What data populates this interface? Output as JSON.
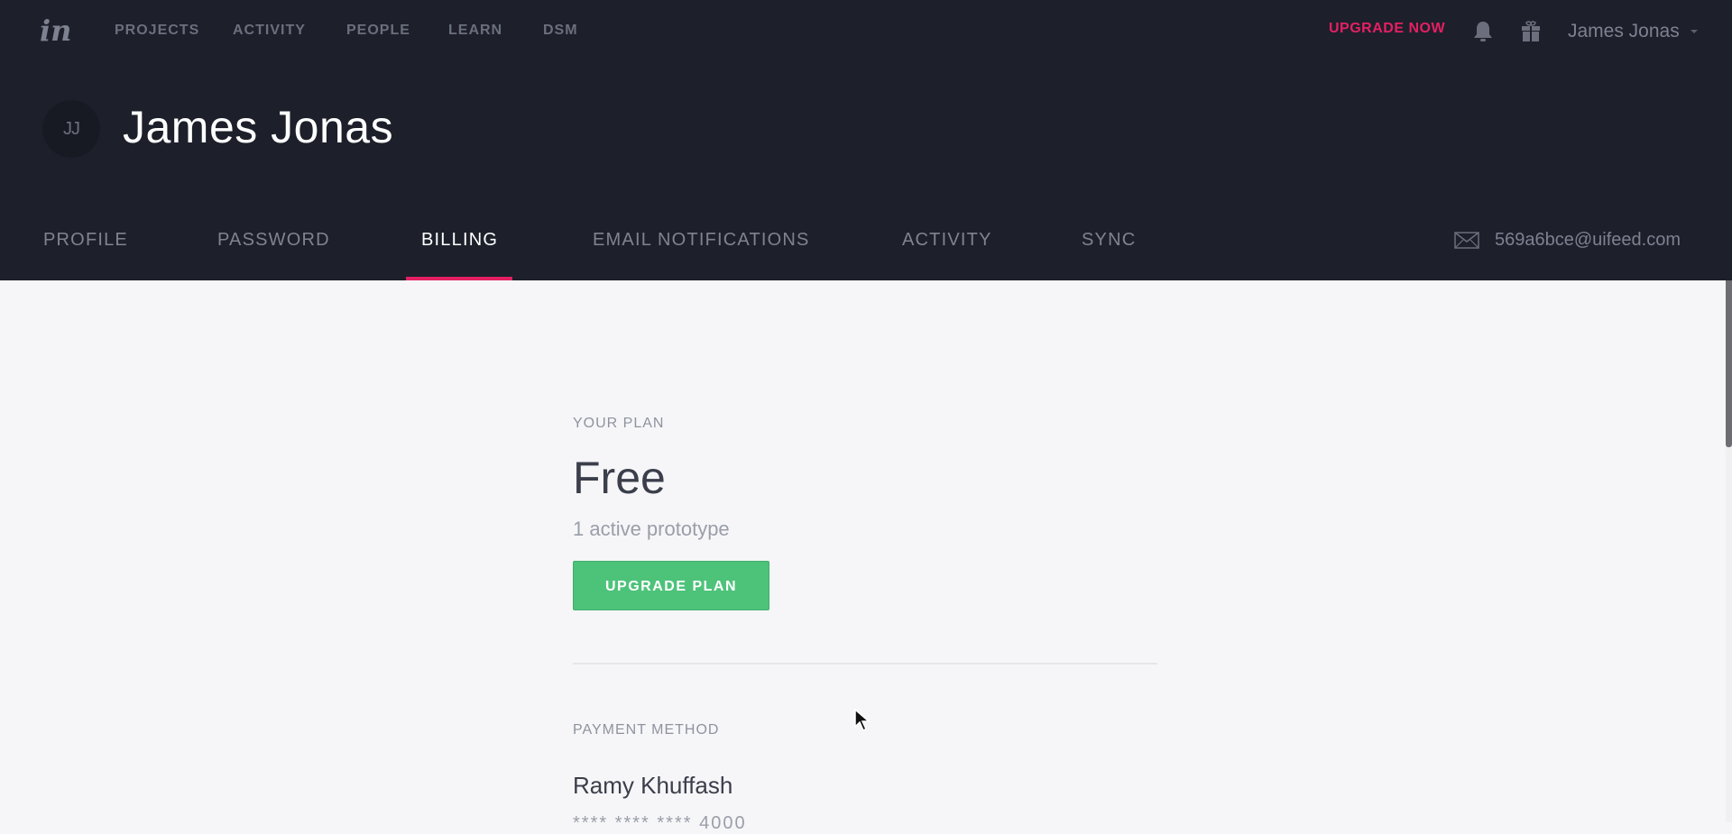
{
  "topnav": {
    "logo": "in",
    "items": [
      {
        "label": "PROJECTS"
      },
      {
        "label": "ACTIVITY"
      },
      {
        "label": "PEOPLE"
      },
      {
        "label": "LEARN"
      },
      {
        "label": "DSM"
      }
    ],
    "upgrade_label": "UPGRADE NOW",
    "notifications_icon": "bell-icon",
    "gift_icon": "gift-icon",
    "user_name": "James Jonas"
  },
  "profile": {
    "avatar_initials": "JJ",
    "name": "James Jonas",
    "email": "569a6bce@uifeed.com"
  },
  "tabs": [
    {
      "label": "PROFILE",
      "active": false
    },
    {
      "label": "PASSWORD",
      "active": false
    },
    {
      "label": "BILLING",
      "active": true
    },
    {
      "label": "EMAIL NOTIFICATIONS",
      "active": false
    },
    {
      "label": "ACTIVITY",
      "active": false
    },
    {
      "label": "SYNC",
      "active": false
    }
  ],
  "billing": {
    "plan_label": "YOUR PLAN",
    "plan_name": "Free",
    "plan_description": "1 active prototype",
    "upgrade_button": "UPGRADE PLAN",
    "payment_label": "PAYMENT METHOD",
    "card_holder": "Ramy Khuffash",
    "card_number": "**** **** **** 4000"
  },
  "colors": {
    "header_bg": "#1d202b",
    "accent": "#e51f63",
    "button_green": "#4dc37a",
    "page_bg": "#f6f6f8"
  }
}
